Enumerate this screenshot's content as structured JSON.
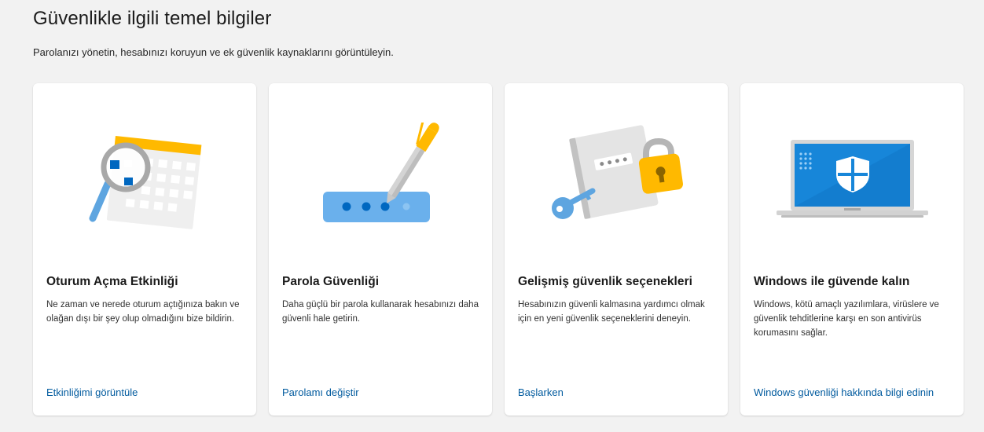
{
  "page": {
    "title": "Güvenlikle ilgili temel bilgiler",
    "subtitle": "Parolanızı yönetin, hesabınızı koruyun ve ek güvenlik kaynaklarını görüntüleyin."
  },
  "colors": {
    "background": "#f2f2f2",
    "card": "#ffffff",
    "link": "#005a9e",
    "accent_yellow": "#ffb900",
    "accent_blue": "#0078d4"
  },
  "cards": [
    {
      "icon": "magnifier-calendar-illustration",
      "title": "Oturum Açma Etkinliği",
      "description": "Ne zaman ve nerede oturum açtığınıza bakın ve olağan dışı bir şey olup olmadığını bize bildirin.",
      "link": "Etkinliğimi görüntüle"
    },
    {
      "icon": "password-pen-illustration",
      "title": "Parola Güvenliği",
      "description": "Daha güçlü bir parola kullanarak hesabınızı daha güvenli hale getirin.",
      "link": "Parolamı değiştir"
    },
    {
      "icon": "notebook-key-lock-illustration",
      "title": "Gelişmiş güvenlik seçenekleri",
      "description": "Hesabınızın güvenli kalmasına yardımcı olmak için en yeni güvenlik seçeneklerini deneyin.",
      "link": "Başlarken"
    },
    {
      "icon": "laptop-shield-illustration",
      "title": "Windows ile güvende kalın",
      "description": "Windows, kötü amaçlı yazılımlara, virüslere ve güvenlik tehditlerine karşı en son antivirüs korumasını sağlar.",
      "link": "Windows güvenliği hakkında bilgi edinin"
    }
  ]
}
